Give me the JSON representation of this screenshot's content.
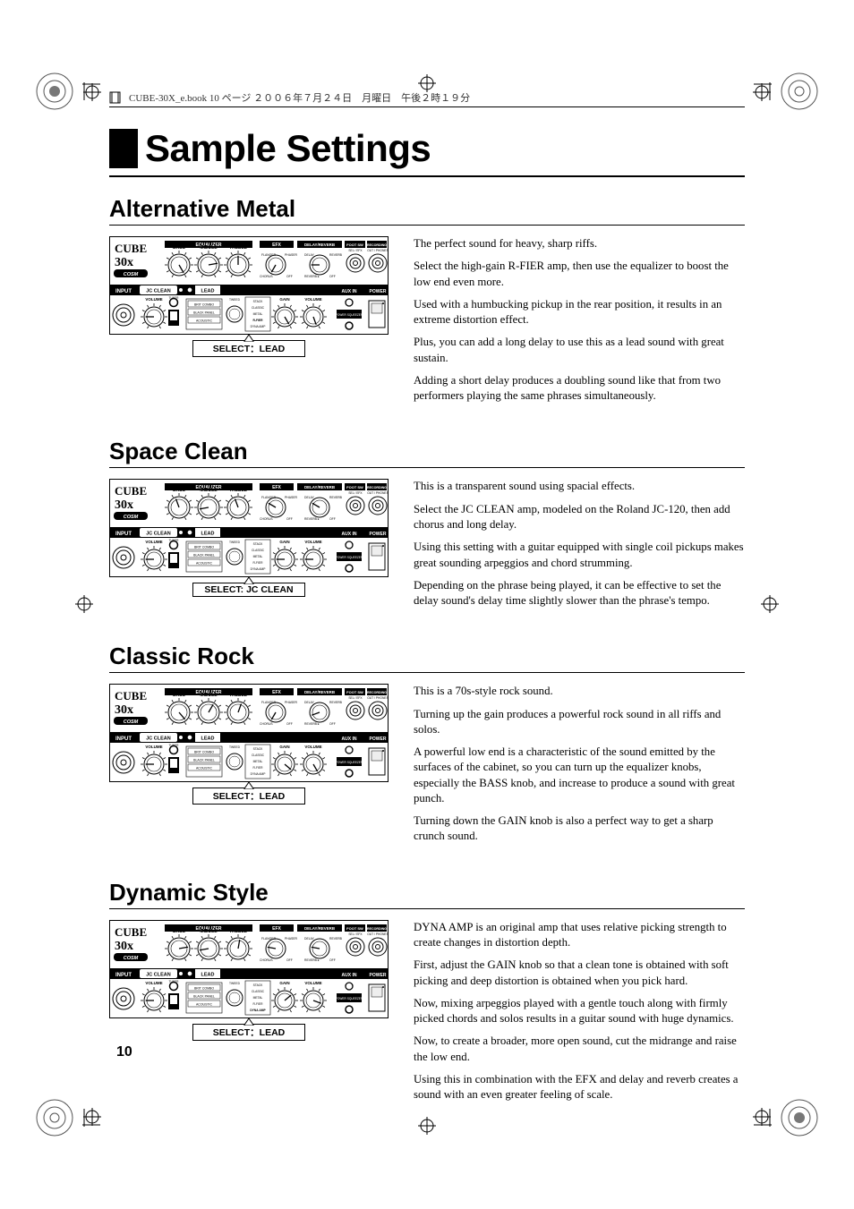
{
  "header": {
    "file_info": "CUBE-30X_e.book   10 ページ   ２００６年７月２４日　月曜日　午後２時１９分"
  },
  "title": "Sample Settings",
  "page_number": "10",
  "panel": {
    "brand_lines": [
      "CUBE",
      "30x",
      "COSM"
    ],
    "labels": {
      "input": "INPUT",
      "jc_clean": "JC CLEAN",
      "lead": "LEAD",
      "volume": "VOLUME",
      "tuner": "TUNER",
      "eq_header": "EQUALIZER",
      "bass": "BASS",
      "middle": "MIDDLE",
      "treble": "TREBLE",
      "efx": "EFX",
      "delay_reverb": "DELAY/REVERB",
      "foot_sw": "FOOT SW",
      "recording": "RECORDING",
      "gain": "GAIN",
      "lead_volume": "VOLUME",
      "aux_in": "AUX IN",
      "power": "POWER",
      "amp_list": [
        "BRIT COMBO",
        "BLACK PANEL",
        "ACOUSTIC"
      ],
      "amp_list_right": [
        "STACK",
        "CLASSIC",
        "METAL",
        "R-FIER",
        "DYNA AMP"
      ],
      "power_squeezer": "POWER SQUEEZER",
      "select_prefix": "SELECT："
    }
  },
  "settings": [
    {
      "title": "Alternative Metal",
      "select": "SELECT：LEAD",
      "paragraphs": [
        "The perfect sound for heavy, sharp riffs.",
        "Select the high-gain R-FIER amp, then use the equalizer to boost the low end even more.",
        "Used with a humbucking pickup in the rear position, it results in an extreme distortion effect.",
        "Plus, you can add a long delay to use this as a lead sound with great sustain.",
        "Adding a short delay produces a doubling sound like that from two performers playing the same phrases simultaneously."
      ],
      "knobs": {
        "bass": 300,
        "middle": 230,
        "treble": 150,
        "efx": 0,
        "delay": 60,
        "gain": 300,
        "leadvol": 310,
        "amp_type": "R-FIER"
      }
    },
    {
      "title": "Space Clean",
      "select": "SELECT: JC CLEAN",
      "paragraphs": [
        "This is a transparent sound using spacial effects.",
        "Select the JC CLEAN amp, modeled on the Roland JC-120, then add chorus and long delay.",
        "Using this setting with a guitar equipped with single coil pickups makes great sounding arpeggios and chord strumming.",
        "Depending on the phrase being played, it can be effective to set the delay sound's delay time slightly slower than the phrase's tempo."
      ],
      "knobs": {
        "bass": 130,
        "middle": 50,
        "treble": 130,
        "efx": 90,
        "delay": 90,
        "gain": 60,
        "leadvol": 60,
        "amp_type": ""
      }
    },
    {
      "title": "Classic Rock",
      "select": "SELECT：LEAD",
      "paragraphs": [
        "This is a 70s-style rock sound.",
        "Turning up the gain produces a powerful rock sound in all riffs and solos.",
        "A powerful low end is a characteristic of the sound emitted by the surfaces of the cabinet, so you can turn up the equalizer knobs, especially the BASS knob, and increase to produce a sound with great punch.",
        "Turning down the GAIN knob is also a perfect way to get a sharp crunch sound."
      ],
      "knobs": {
        "bass": 290,
        "middle": 180,
        "treble": 170,
        "efx": 0,
        "delay": 40,
        "gain": 280,
        "leadvol": 300,
        "amp_type": "STACK CLASSIC"
      }
    },
    {
      "title": "Dynamic Style",
      "select": "SELECT：LEAD",
      "paragraphs": [
        "DYNA AMP is an original amp that uses relative picking strength to create changes in distortion depth.",
        "First, adjust the GAIN knob so that a clean tone is obtained with soft picking and deep distortion is obtained when you pick hard.",
        "Now, mixing arpeggios played with a gentle touch along with firmly picked chords and solos results in a guitar sound with huge dynamics.",
        "Now, to create a broader, more open sound, cut the midrange and raise the low end.",
        "Using this in combination with the EFX and delay and reverb creates a sound with an even greater feeling of scale."
      ],
      "knobs": {
        "bass": 230,
        "middle": 50,
        "treble": 160,
        "efx": 70,
        "delay": 70,
        "gain": 200,
        "leadvol": 260,
        "amp_type": "DYNA AMP"
      }
    }
  ]
}
